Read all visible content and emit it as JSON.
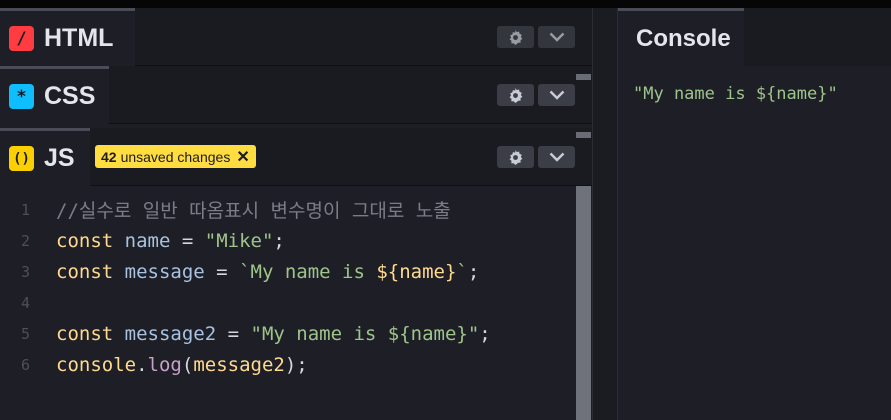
{
  "panels": {
    "html": {
      "badge": "/",
      "label": "HTML",
      "color": "#ff3c41"
    },
    "css": {
      "badge": "*",
      "label": "CSS",
      "color": "#0ebeff"
    },
    "js": {
      "badge": "()",
      "label": "JS",
      "color": "#fcd000"
    }
  },
  "unsaved": {
    "count": "42",
    "text": "unsaved changes",
    "close": "✕"
  },
  "icons": {
    "settings": "gear-icon",
    "collapse": "chevron-down-icon"
  },
  "code": {
    "line_numbers": [
      "1",
      "2",
      "3",
      "4",
      "5",
      "6"
    ],
    "comment": "//실수로 일반 따옴표시 변수명이 그대로 노출",
    "l2": {
      "kw": "const",
      "var": "name",
      "op": " = ",
      "str": "\"Mike\"",
      "end": ";"
    },
    "l3": {
      "kw": "const",
      "var": "message",
      "op": " = ",
      "str_a": "`My name is ",
      "tv": "${name}",
      "str_b": "`",
      "end": ";"
    },
    "l5": {
      "kw": "const",
      "var": "message2",
      "op": " = ",
      "str": "\"My name is ${name}\"",
      "end": ";"
    },
    "l6": {
      "obj": "console",
      "dot": ".",
      "fn": "log",
      "open": "(",
      "arg": "message2",
      "close": ");"
    }
  },
  "console": {
    "title": "Console",
    "output": "\"My name is ${name}\""
  }
}
